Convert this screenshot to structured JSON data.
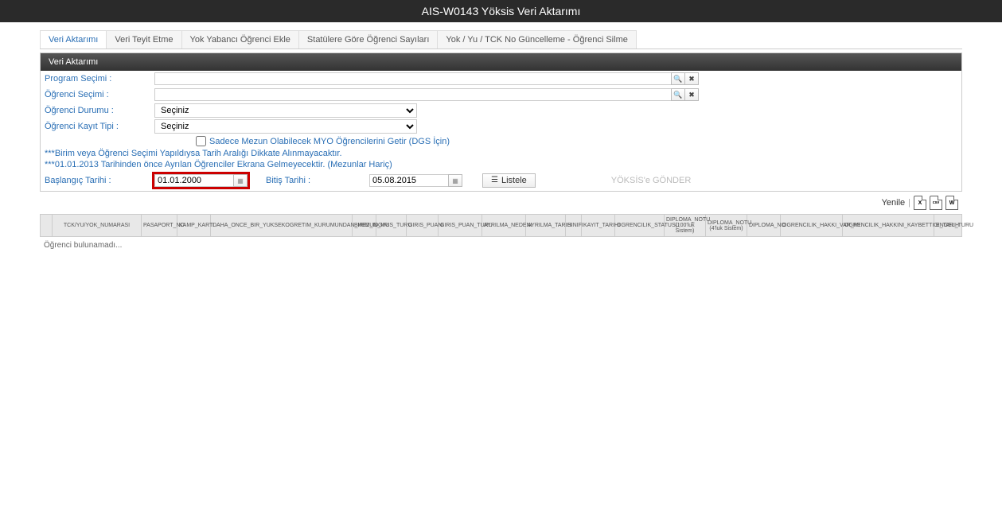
{
  "header": {
    "title": "AIS-W0143 Yöksis Veri Aktarımı"
  },
  "tabs": [
    {
      "label": "Veri Aktarımı",
      "active": true
    },
    {
      "label": "Veri Teyit Etme",
      "active": false
    },
    {
      "label": "Yok Yabancı Öğrenci Ekle",
      "active": false
    },
    {
      "label": "Statülere Göre Öğrenci Sayıları",
      "active": false
    },
    {
      "label": "Yok / Yu / TCK No Güncelleme - Öğrenci Silme",
      "active": false
    }
  ],
  "panel": {
    "title": "Veri Aktarımı"
  },
  "form": {
    "program_label": "Program Seçimi :",
    "program_value": "",
    "student_label": "Öğrenci Seçimi :",
    "student_value": "",
    "status_label": "Öğrenci Durumu :",
    "status_selected": "Seçiniz",
    "regtype_label": "Öğrenci Kayıt Tipi :",
    "regtype_selected": "Seçiniz",
    "checkbox_label": "Sadece Mezun Olabilecek MYO Öğrencilerini Getir (DGS İçin)",
    "note1": "***Birim veya Öğrenci Seçimi Yapıldıysa Tarih Aralığı Dikkate Alınmayacaktır.",
    "note2": "***01.01.2013 Tarihinden önce Ayrılan Öğrenciler Ekrana Gelmeyecektir. (Mezunlar Hariç)",
    "start_date_label": "Başlangıç Tarihi :",
    "start_date_value": "01.01.2000",
    "end_date_label": "Bitiş Tarihi :",
    "end_date_value": "05.08.2015",
    "list_button": "Listele",
    "send_button": "YÖKSİS'e GÖNDER"
  },
  "toolbar": {
    "refresh": "Yenile",
    "export_x": "X",
    "export_csv": "csv",
    "export_w": "W"
  },
  "columns": [
    "",
    "TCK/YU/YOK_NUMARASI",
    "PASAPORT_NO",
    "KAMP_KARTI",
    "DAHA_ONCE_BIR_YUKSEKOGRETIM_KURUMUNDAN_MEZUN_MU",
    "BIRIM_ID",
    "GIRIS_TURU",
    "GIRIS_PUANI",
    "GIRIS_PUAN_TURU",
    "AYRILMA_NEDENI",
    "AYRILMA_TARIHI",
    "SINIFI",
    "KAYIT_TARIHI",
    "OGRENCILIK_STATUSU",
    "DIPLOMA_NOTU (100'luk Sistem)",
    "DIPLOMA_NOTU (4'luk Sistem)",
    "DIPLOMA_NO",
    "OGRENCILIK_HAKKI_VAR_MI",
    "OGRENCILIK_HAKKINI_KAYBETTIGI_TARIH",
    "ENGEL_TURU"
  ],
  "no_data_text": "Öğrenci bulunamadı..."
}
